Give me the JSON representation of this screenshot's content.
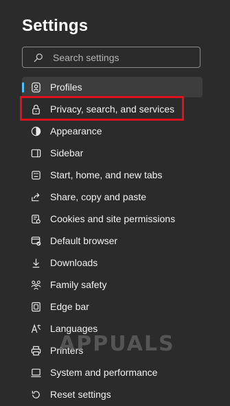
{
  "settings": {
    "title": "Settings",
    "search_placeholder": "Search settings"
  },
  "nav": {
    "items": [
      {
        "label": "Profiles",
        "icon": "profile-icon",
        "active": true
      },
      {
        "label": "Privacy, search, and services",
        "icon": "lock-icon",
        "highlighted": true
      },
      {
        "label": "Appearance",
        "icon": "appearance-icon"
      },
      {
        "label": "Sidebar",
        "icon": "sidebar-icon"
      },
      {
        "label": "Start, home, and new tabs",
        "icon": "start-home-icon"
      },
      {
        "label": "Share, copy and paste",
        "icon": "share-icon"
      },
      {
        "label": "Cookies and site permissions",
        "icon": "cookies-icon"
      },
      {
        "label": "Default browser",
        "icon": "default-browser-icon"
      },
      {
        "label": "Downloads",
        "icon": "download-icon"
      },
      {
        "label": "Family safety",
        "icon": "family-icon"
      },
      {
        "label": "Edge bar",
        "icon": "edge-bar-icon"
      },
      {
        "label": "Languages",
        "icon": "languages-icon"
      },
      {
        "label": "Printers",
        "icon": "printer-icon"
      },
      {
        "label": "System and performance",
        "icon": "system-icon"
      },
      {
        "label": "Reset settings",
        "icon": "reset-icon"
      }
    ]
  },
  "colors": {
    "active_indicator": "#4cc2ff",
    "highlight_box": "#e0121b"
  },
  "watermark": "APPUALS"
}
